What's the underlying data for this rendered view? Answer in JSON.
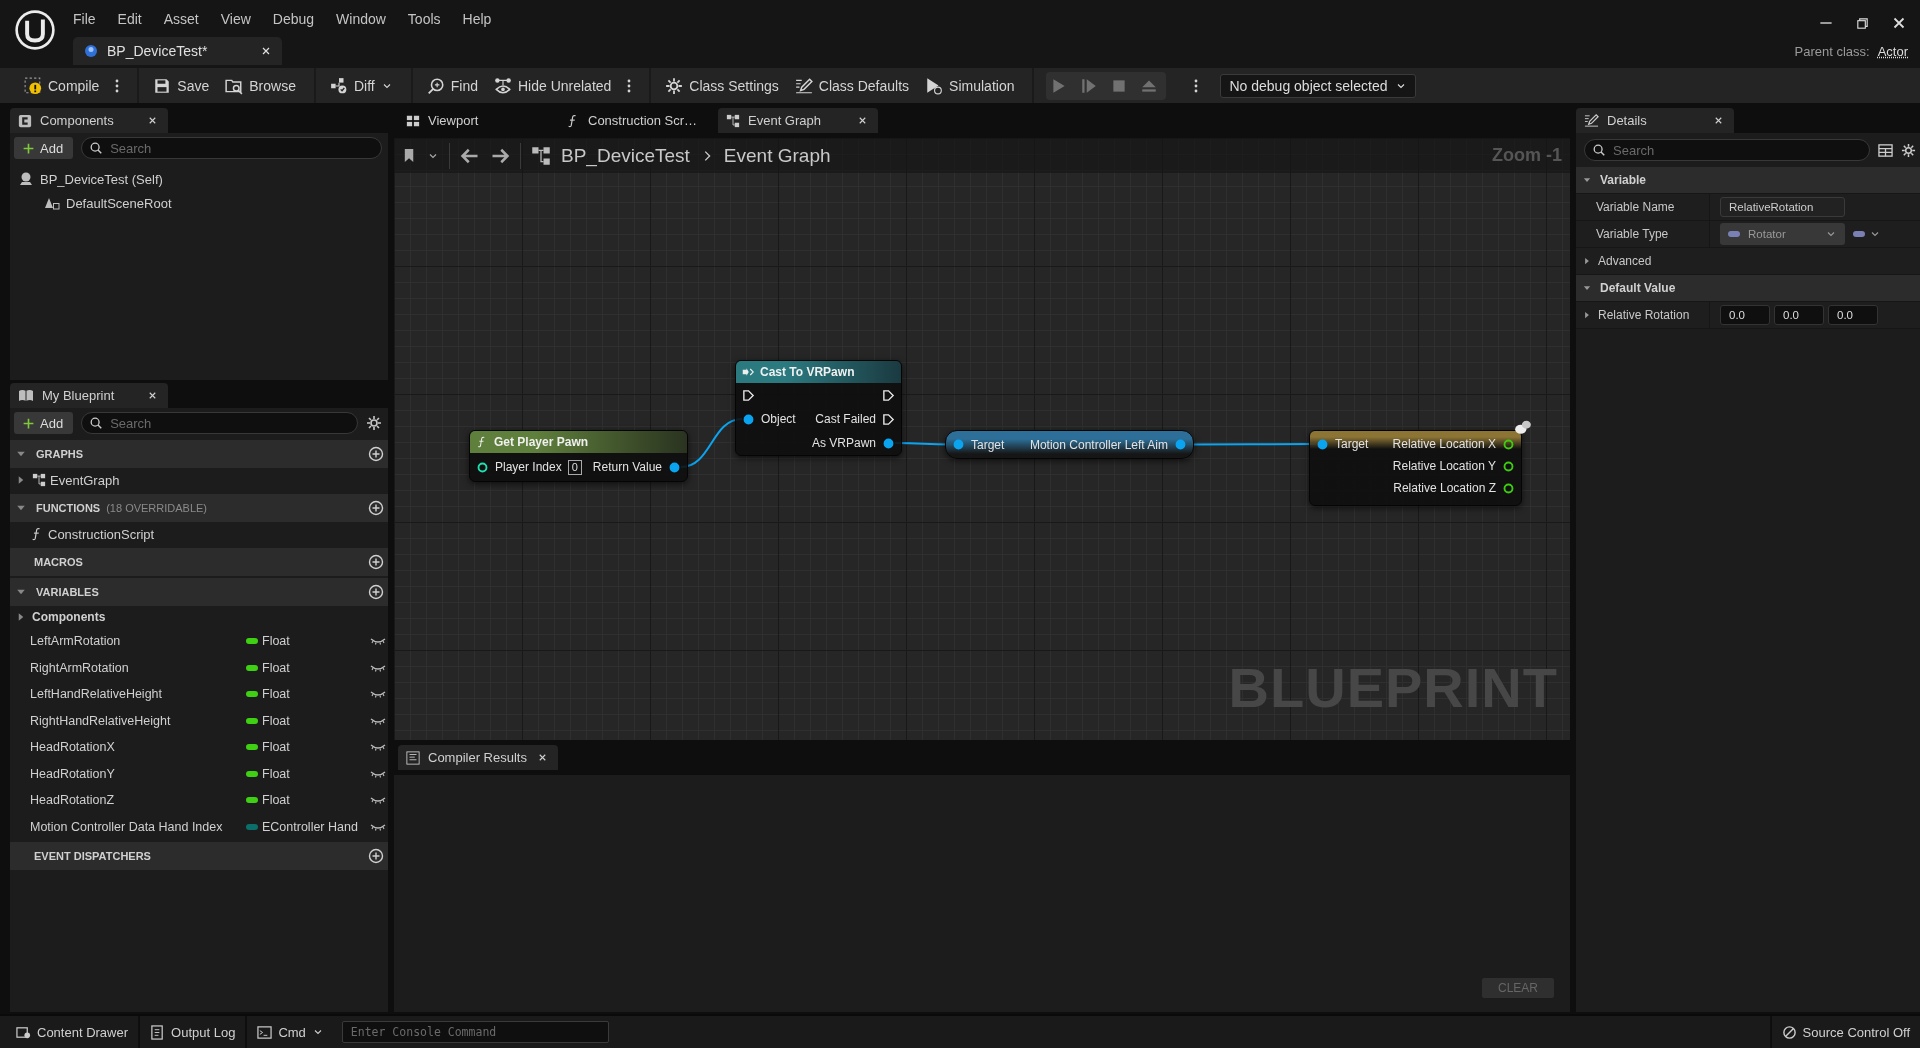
{
  "titlebar": {
    "menu": [
      "File",
      "Edit",
      "Asset",
      "View",
      "Debug",
      "Window",
      "Tools",
      "Help"
    ],
    "document_tab": {
      "title": "BP_DeviceTest*"
    },
    "parent_class": {
      "label": "Parent class:",
      "value": "Actor"
    }
  },
  "toolbar": {
    "groups": [
      {
        "kind": "actions",
        "items": [
          {
            "kind": "compile",
            "label": "Compile",
            "disabled": false
          },
          {
            "kind": "more",
            "disabled": false
          }
        ]
      },
      {
        "kind": "actions",
        "items": [
          {
            "kind": "save",
            "label": "Save",
            "disabled": false
          },
          {
            "kind": "browse",
            "label": "Browse",
            "disabled": false
          }
        ]
      },
      {
        "kind": "actions",
        "items": [
          {
            "kind": "diff",
            "label": "Diff",
            "disabled": false
          }
        ]
      },
      {
        "kind": "actions",
        "items": [
          {
            "kind": "find",
            "label": "Find",
            "disabled": false
          },
          {
            "kind": "hide",
            "label": "Hide Unrelated",
            "disabled": false
          },
          {
            "kind": "more",
            "disabled": false
          }
        ]
      },
      {
        "kind": "actions",
        "items": [
          {
            "kind": "settings",
            "label": "Class Settings",
            "disabled": false
          },
          {
            "kind": "defaults",
            "label": "Class Defaults",
            "disabled": false
          },
          {
            "kind": "simulation",
            "label": "Simulation",
            "disabled": false
          }
        ]
      },
      {
        "kind": "playback",
        "items": [
          {
            "kind": "play",
            "disabled": true
          },
          {
            "kind": "step",
            "disabled": true
          },
          {
            "kind": "stop",
            "disabled": true
          },
          {
            "kind": "eject",
            "disabled": true
          },
          {
            "kind": "more",
            "disabled": false
          }
        ]
      }
    ],
    "debug_object": {
      "label": "No debug object selected"
    }
  },
  "components": {
    "tab": "Components",
    "add_button": "Add",
    "search_placeholder": "Search",
    "tree": [
      {
        "kind": "actor",
        "label": "BP_DeviceTest (Self)",
        "children": [
          {
            "kind": "scene",
            "label": "DefaultSceneRoot"
          }
        ]
      }
    ]
  },
  "my_blueprint": {
    "tab": "My Blueprint",
    "add_button": "Add",
    "search_placeholder": "Search",
    "sections": [
      {
        "title": "GRAPHS",
        "expanded": true,
        "items": [
          {
            "kind": "graph",
            "label": "EventGraph",
            "expanded": false
          }
        ]
      },
      {
        "title": "FUNCTIONS",
        "note": "(18 OVERRIDABLE)",
        "expanded": true,
        "items": [
          {
            "kind": "function",
            "label": "ConstructionScript"
          }
        ]
      },
      {
        "title": "MACROS",
        "expanded": false
      },
      {
        "title": "VARIABLES",
        "expanded": true,
        "items": [
          {
            "kind": "category",
            "label": "Components",
            "expanded": false
          },
          {
            "kind": "variable",
            "label": "LeftArmRotation",
            "type": "Float",
            "color": "#3fd014",
            "instance_editable": false
          },
          {
            "kind": "variable",
            "label": "RightArmRotation",
            "type": "Float",
            "color": "#3fd014",
            "instance_editable": false
          },
          {
            "kind": "variable",
            "label": "LeftHandRelativeHeight",
            "type": "Float",
            "color": "#3fd014",
            "instance_editable": false
          },
          {
            "kind": "variable",
            "label": "RightHandRelativeHeight",
            "type": "Float",
            "color": "#3fd014",
            "instance_editable": false
          },
          {
            "kind": "variable",
            "label": "HeadRotationX",
            "type": "Float",
            "color": "#3fd014",
            "instance_editable": false
          },
          {
            "kind": "variable",
            "label": "HeadRotationY",
            "type": "Float",
            "color": "#3fd014",
            "instance_editable": false
          },
          {
            "kind": "variable",
            "label": "HeadRotationZ",
            "type": "Float",
            "color": "#3fd014",
            "instance_editable": false
          },
          {
            "kind": "variable",
            "label": "Motion Controller Data Hand Index",
            "type": "EController Hand",
            "color": "#0b6e68",
            "instance_editable": false
          }
        ]
      },
      {
        "title": "EVENT DISPATCHERS",
        "expanded": false
      }
    ]
  },
  "graph_tabs": [
    {
      "kind": "viewport",
      "label": "Viewport",
      "selected": false
    },
    {
      "kind": "function",
      "label": "Construction Scr…",
      "selected": false
    },
    {
      "kind": "graph",
      "label": "Event Graph",
      "selected": true
    }
  ],
  "graph": {
    "breadcrumb": [
      "BP_DeviceTest",
      "Event Graph"
    ],
    "zoom": "Zoom -1",
    "watermark": "BLUEPRINT",
    "nodes": [
      {
        "kind": "function",
        "title": "Get Player Pawn",
        "color": "#5f7f3c",
        "comment_bubble": false,
        "rows": [
          {
            "left": {
              "kind": "int",
              "label": "Player Index",
              "value": "0",
              "connected": false
            },
            "right": {
              "kind": "object",
              "label": "Return Value",
              "connected": true
            }
          }
        ]
      },
      {
        "kind": "cast",
        "title": "Cast To VRPawn",
        "color": "#2b7a80",
        "comment_bubble": false,
        "rows": [
          {
            "left": {
              "kind": "exec",
              "connected": false
            },
            "right": {
              "kind": "exec",
              "connected": false
            }
          },
          {
            "left": {
              "kind": "object",
              "label": "Object",
              "connected": true
            },
            "right": {
              "kind": "exec",
              "label": "Cast Failed",
              "connected": false
            }
          },
          {
            "right": {
              "kind": "object",
              "label": "As VRPawn",
              "connected": true
            }
          }
        ]
      },
      {
        "kind": "compact",
        "color": "#2d6f98",
        "comment_bubble": false,
        "rows": [
          {
            "left": {
              "kind": "object",
              "label": "Target",
              "connected": true
            },
            "right": {
              "kind": "object",
              "label": "Motion Controller Left Aim",
              "connected": true
            }
          }
        ]
      },
      {
        "kind": "break",
        "color": "#8c7434",
        "comment_bubble": true,
        "rows": [
          {
            "left": {
              "kind": "object",
              "label": "Target",
              "connected": true
            },
            "right": {
              "kind": "float",
              "label": "Relative Location X",
              "connected": false
            }
          },
          {
            "right": {
              "kind": "float",
              "label": "Relative Location Y",
              "connected": false
            }
          },
          {
            "right": {
              "kind": "float",
              "label": "Relative Location Z",
              "connected": false
            }
          }
        ]
      }
    ]
  },
  "compiler": {
    "tab": "Compiler Results",
    "clear_button": {
      "label": "CLEAR",
      "disabled": true
    }
  },
  "details": {
    "tab": "Details",
    "search_placeholder": "Search",
    "sections": [
      {
        "title": "Variable",
        "expanded": true,
        "rows": [
          {
            "kind": "text",
            "label": "Variable Name",
            "value": "RelativeRotation"
          },
          {
            "kind": "type",
            "label": "Variable Type",
            "value": "Rotator",
            "color": "#7a80b4"
          },
          {
            "kind": "group",
            "label": "Advanced",
            "expanded": false
          }
        ]
      },
      {
        "title": "Default Value",
        "expanded": true,
        "rows": [
          {
            "kind": "vector",
            "label": "Relative Rotation",
            "expanded": false,
            "values": [
              "0.0",
              "0.0",
              "0.0"
            ]
          }
        ]
      }
    ]
  },
  "statusbar": {
    "items": [
      {
        "kind": "drawer",
        "label": "Content Drawer"
      },
      {
        "kind": "log",
        "label": "Output Log"
      },
      {
        "kind": "cmd",
        "label": "Cmd"
      }
    ],
    "console_placeholder": "Enter Console Command",
    "source_control": "Source Control Off"
  }
}
